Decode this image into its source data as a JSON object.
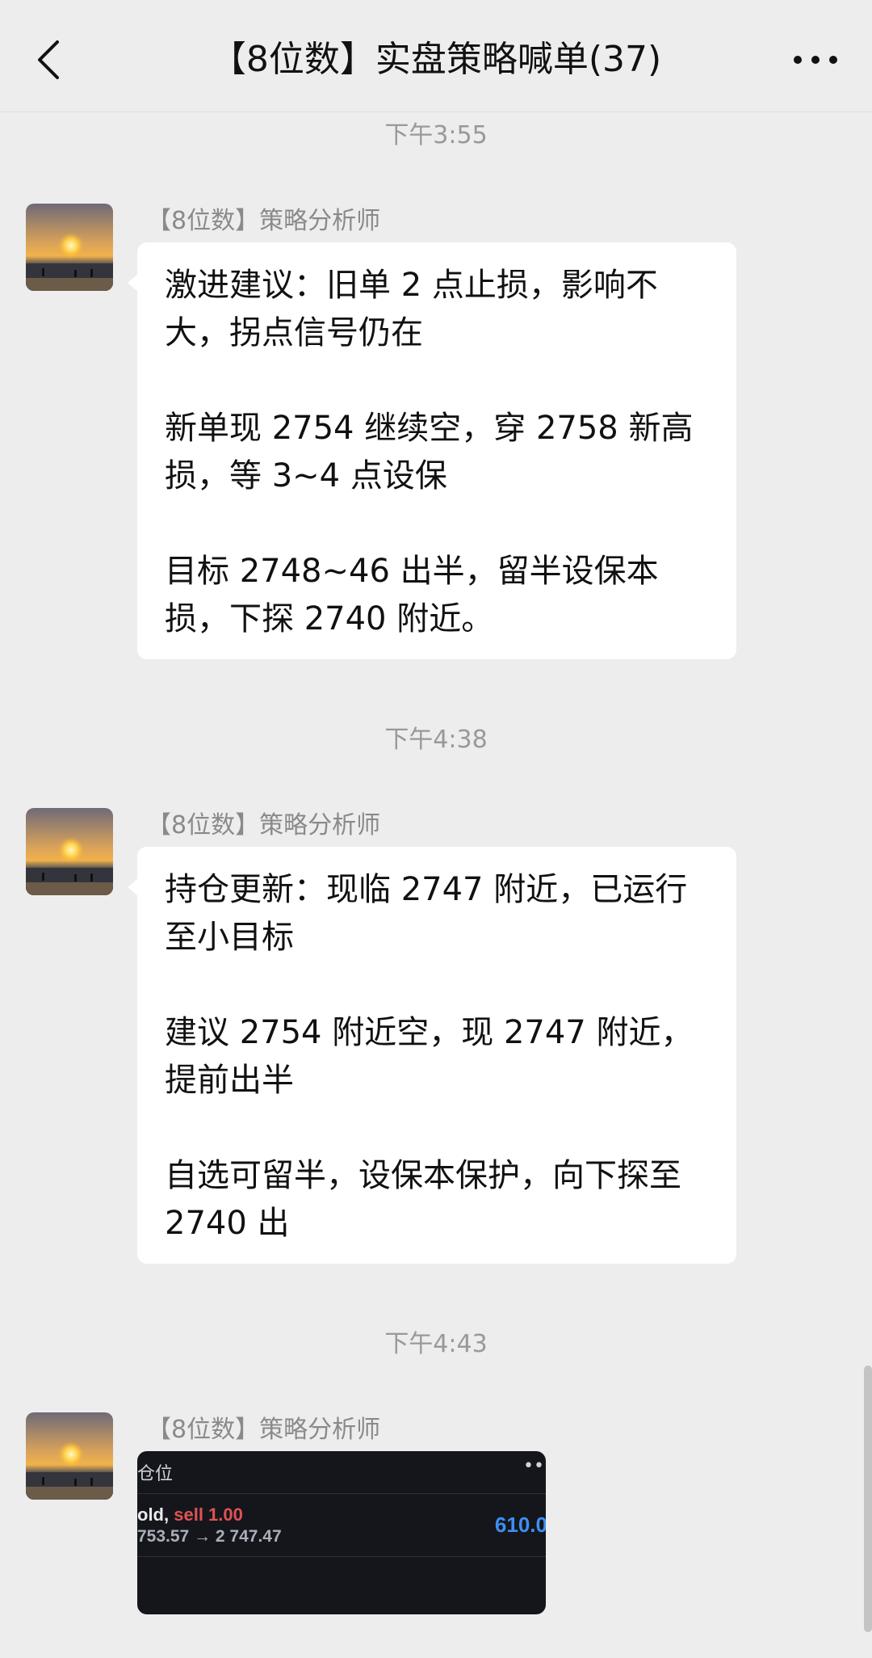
{
  "header": {
    "title": "【8位数】实盘策略喊单(37)",
    "back_icon": "chevron-left-icon",
    "more_icon": "more-horizontal-icon"
  },
  "messages": [
    {
      "time": "下午3:55",
      "sender": "【8位数】策略分析师",
      "paragraphs": [
        "激进建议：旧单 2 点止损，影响不大，拐点信号仍在",
        "新单现 2754 继续空，穿 2758 新高损，等 3~4 点设保",
        "目标 2748~46 出半，留半设保本损，下探 2740 附近。"
      ]
    },
    {
      "time": "下午4:38",
      "sender": "【8位数】策略分析师",
      "paragraphs": [
        "持仓更新：现临 2747 附近，已运行至小目标",
        "建议 2754 附近空，现 2747 附近，提前出半",
        "自选可留半，设保本保护，向下探至 2740 出"
      ]
    },
    {
      "time": "下午4:43",
      "sender": "【8位数】策略分析师",
      "image": {
        "header": "仓位",
        "symbol": "old,",
        "side": "sell 1.00",
        "price_line": "753.57 → 2 747.47",
        "profit": "610.0"
      }
    }
  ],
  "colors": {
    "background": "#ededed",
    "bubble": "#ffffff",
    "time_text": "#999999",
    "sender_text": "#8a8a8a",
    "sell_red": "#e05252",
    "profit_blue": "#3d8ff0"
  }
}
